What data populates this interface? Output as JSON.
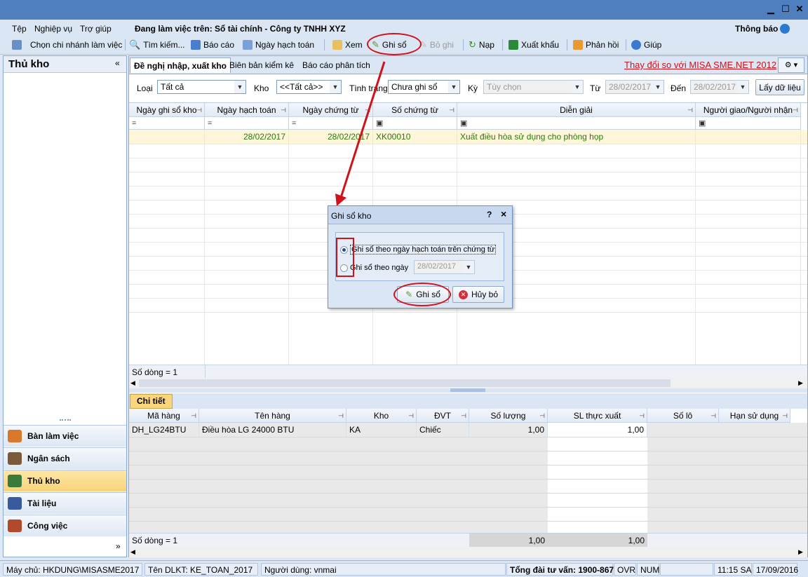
{
  "menu": {
    "file": "Tệp",
    "business": "Nghiệp vụ",
    "help": "Trợ giúp",
    "working_on": "Đang làm việc trên: Sổ tài chính - Công ty TNHH XYZ",
    "notifications": "Thông báo"
  },
  "toolbar": {
    "choose_branch": "Chọn chi nhánh làm việc",
    "search": "Tìm kiếm...",
    "report": "Báo cáo",
    "posting_date": "Ngày hạch toán",
    "view": "Xem",
    "post": "Ghi sổ",
    "unpost": "Bỏ ghi",
    "reload": "Nạp",
    "export": "Xuất khẩu",
    "feedback": "Phản hồi",
    "help": "Giúp"
  },
  "left": {
    "title": "Thủ kho",
    "nav": [
      {
        "label": "Bàn làm việc",
        "color": "#d9772a"
      },
      {
        "label": "Ngân sách",
        "color": "#7a5a3a"
      },
      {
        "label": "Thủ kho",
        "color": "#3a7a3a"
      },
      {
        "label": "Tài liệu",
        "color": "#3a5aa0"
      },
      {
        "label": "Công việc",
        "color": "#b04a2a"
      }
    ]
  },
  "tabs": {
    "t1": "Đề nghị nhập, xuất kho",
    "t2": "Biên bản kiểm kê",
    "t3": "Báo cáo phân tích",
    "change_link": "Thay đổi so với MISA SME.NET 2012"
  },
  "filters": {
    "type_label": "Loại",
    "type_value": "Tất cả",
    "warehouse_label": "Kho",
    "warehouse_value": "<<Tất cả>>",
    "status_label": "Tình trạng",
    "status_value": "Chưa ghi sổ",
    "period_label": "Kỳ",
    "period_value": "Tùy chọn",
    "from_label": "Từ",
    "from_value": "28/02/2017",
    "to_label": "Đến",
    "to_value": "28/02/2017",
    "get_data": "Lấy dữ liệu"
  },
  "grid": {
    "columns": [
      "Ngày ghi sổ kho",
      "Ngày hạch toán",
      "Ngày chứng từ",
      "Số chứng từ",
      "Diễn giải",
      "Người giao/Người nhận"
    ],
    "row": {
      "posting": "28/02/2017",
      "doc_date": "28/02/2017",
      "doc_no": "XK00010",
      "desc": "Xuất điều hòa sử dụng cho phòng họp"
    },
    "row_count": "Số dòng = 1"
  },
  "detail": {
    "tab": "Chi tiết",
    "columns": [
      "Mã hàng",
      "Tên hàng",
      "Kho",
      "ĐVT",
      "Số lượng",
      "SL thực xuất",
      "Số lô",
      "Hạn sử dụng"
    ],
    "row": {
      "code": "DH_LG24BTU",
      "name": "Điều hòa LG 24000 BTU",
      "wh": "KA",
      "unit": "Chiếc",
      "qty": "1,00",
      "actual": "1,00"
    },
    "row_count": "Số dòng = 1",
    "sum_qty": "1,00",
    "sum_actual": "1,00"
  },
  "dialog": {
    "title": "Ghi sổ kho",
    "help": "?",
    "close": "×",
    "opt1": "Ghi sổ theo ngày hạch toán trên chứng từ",
    "opt2": "Ghi sổ theo ngày",
    "date": "28/02/2017",
    "ok": "Ghi sổ",
    "cancel": "Hủy bỏ"
  },
  "status": {
    "server": "Máy chủ: HKDUNG\\MISASME2017",
    "db": "Tên DLKT: KE_TOAN_2017",
    "user": "Người dùng: vnmai",
    "hotline": "Tổng đài tư vấn: 1900-8677",
    "ovr": "OVR",
    "num": "NUM",
    "time": "11:15 SA",
    "date": "17/09/2016"
  },
  "colors": {
    "accent": "#d0121b",
    "title_bar": "#4f7fbf",
    "row_highlight": "#fdf6d8",
    "data_text": "#2a7a12"
  }
}
